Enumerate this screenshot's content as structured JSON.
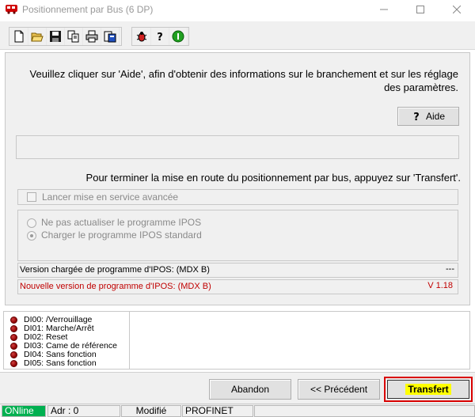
{
  "window": {
    "title": "Positionnement par Bus (6 DP)",
    "minimize_icon": "minimize-icon",
    "maximize_icon": "maximize-icon",
    "close_icon": "close-icon"
  },
  "toolbar": {
    "group1": [
      "new-file-icon",
      "open-folder-icon",
      "save-icon",
      "copy-document-icon",
      "print-icon",
      "export-icon"
    ],
    "group2": [
      "bug-icon",
      "help-icon",
      "info-icon"
    ]
  },
  "main": {
    "info_text": "Veuillez cliquer sur 'Aide', afin d'obtenir des informations sur le branchement et sur les réglage des paramètres.",
    "aide_button": "Aide",
    "status_field": "",
    "transfer_text": "Pour terminer la mise en route du positionnement par  bus, appuyez sur 'Transfert'.",
    "advanced_checkbox": {
      "label": "Lancer mise en service avancée",
      "checked": false,
      "enabled": false
    },
    "radio_options": [
      {
        "label": "Ne pas actualiser le programme IPOS",
        "selected": false
      },
      {
        "label": "Charger le programme IPOS standard",
        "selected": true
      }
    ],
    "loaded_version": {
      "label": "Version chargée de programme d'IPOS: (MDX B)",
      "value": "---"
    },
    "new_version": {
      "label": "Nouvelle version de programme d'IPOS: (MDX B)",
      "value": "V  1.18"
    }
  },
  "di_list": [
    {
      "id": "DI00:",
      "label": "/Verrouillage"
    },
    {
      "id": "DI01:",
      "label": "Marche/Arrêt"
    },
    {
      "id": "DI02:",
      "label": "Reset"
    },
    {
      "id": "DI03:",
      "label": "Came de référence"
    },
    {
      "id": "DI04:",
      "label": "Sans fonction"
    },
    {
      "id": "DI05:",
      "label": "Sans fonction"
    }
  ],
  "buttons": {
    "abandon": "Abandon",
    "precedent": "<< Précédent",
    "transfert": "Transfert"
  },
  "statusbar": {
    "online": "ONline",
    "address": "Adr : 0",
    "mode": "Modifié",
    "network": "PROFINET",
    "extra": ""
  },
  "colors": {
    "online_bg": "#00b050",
    "new_version_text": "#c00000",
    "transfer_highlight": "#ffff00",
    "transfer_border": "#d90000"
  }
}
